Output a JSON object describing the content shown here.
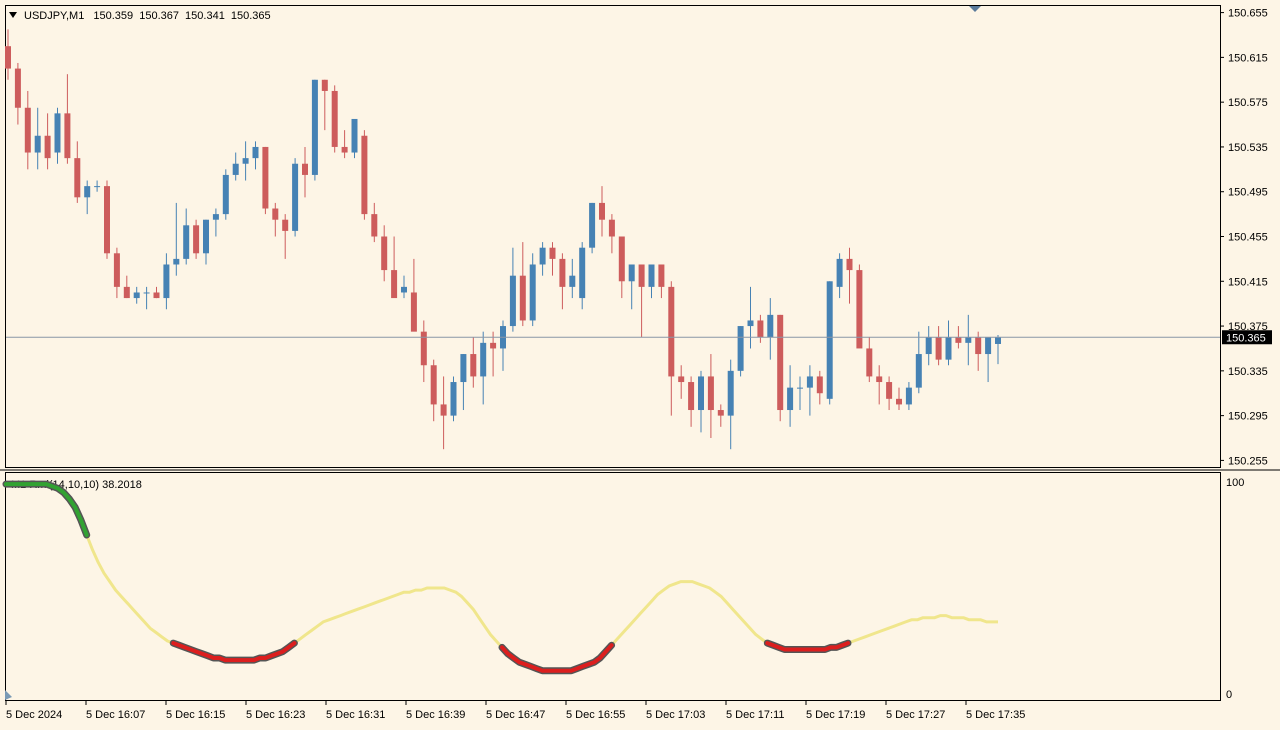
{
  "header": {
    "symbol": "USDJPY,M1",
    "open": "150.359",
    "high": "150.367",
    "low": "150.341",
    "close": "150.365"
  },
  "indicator": {
    "label": "M1 Rmi(14,10,10) 38.2018",
    "scale_max": "100",
    "scale_min": "0"
  },
  "current_price": "150.365",
  "colors": {
    "background": "#fdf5e6",
    "bull": "#4682b4",
    "bear": "#cd5c5c",
    "rmi_neutral": "#f0e68c",
    "rmi_up": "#32a232",
    "rmi_down": "#dc1e1e"
  },
  "chart_data": [
    {
      "type": "candlestick",
      "price_ticks": [
        "150.655",
        "150.615",
        "150.575",
        "150.535",
        "150.495",
        "150.455",
        "150.415",
        "150.375",
        "150.335",
        "150.295",
        "150.255"
      ],
      "ylim": [
        150.25,
        150.66
      ],
      "time_ticks": [
        "5 Dec 2024",
        "5 Dec 16:07",
        "5 Dec 16:15",
        "5 Dec 16:23",
        "5 Dec 16:31",
        "5 Dec 16:39",
        "5 Dec 16:47",
        "5 Dec 16:55",
        "5 Dec 17:03",
        "5 Dec 17:11",
        "5 Dec 17:19",
        "5 Dec 17:27",
        "5 Dec 17:35"
      ],
      "candles": [
        [
          150.625,
          150.64,
          150.595,
          150.605
        ],
        [
          150.605,
          150.61,
          150.555,
          150.57
        ],
        [
          150.57,
          150.585,
          150.515,
          150.53
        ],
        [
          150.53,
          150.57,
          150.515,
          150.545
        ],
        [
          150.545,
          150.565,
          150.515,
          150.525
        ],
        [
          150.53,
          150.57,
          150.52,
          150.565
        ],
        [
          150.565,
          150.6,
          150.52,
          150.525
        ],
        [
          150.525,
          150.54,
          150.485,
          150.49
        ],
        [
          150.49,
          150.505,
          150.475,
          150.5
        ],
        [
          150.5,
          150.505,
          150.495,
          150.5
        ],
        [
          150.5,
          150.505,
          150.435,
          150.44
        ],
        [
          150.44,
          150.445,
          150.4,
          150.41
        ],
        [
          150.41,
          150.42,
          150.4,
          150.4
        ],
        [
          150.4,
          150.41,
          150.395,
          150.405
        ],
        [
          150.405,
          150.41,
          150.39,
          150.405
        ],
        [
          150.405,
          150.41,
          150.4,
          150.4
        ],
        [
          150.4,
          150.44,
          150.39,
          150.43
        ],
        [
          150.43,
          150.485,
          150.42,
          150.435
        ],
        [
          150.435,
          150.48,
          150.43,
          150.465
        ],
        [
          150.465,
          150.47,
          150.435,
          150.44
        ],
        [
          150.44,
          150.47,
          150.43,
          150.47
        ],
        [
          150.47,
          150.48,
          150.455,
          150.475
        ],
        [
          150.475,
          150.515,
          150.47,
          150.51
        ],
        [
          150.51,
          150.53,
          150.505,
          150.52
        ],
        [
          150.52,
          150.54,
          150.505,
          150.525
        ],
        [
          150.525,
          150.54,
          150.515,
          150.535
        ],
        [
          150.535,
          150.535,
          150.475,
          150.48
        ],
        [
          150.48,
          150.485,
          150.455,
          150.47
        ],
        [
          150.47,
          150.475,
          150.435,
          150.46
        ],
        [
          150.46,
          150.525,
          150.455,
          150.52
        ],
        [
          150.52,
          150.535,
          150.49,
          150.51
        ],
        [
          150.51,
          150.595,
          150.505,
          150.595
        ],
        [
          150.595,
          150.595,
          150.55,
          150.585
        ],
        [
          150.585,
          150.59,
          150.53,
          150.535
        ],
        [
          150.535,
          150.55,
          150.525,
          150.53
        ],
        [
          150.53,
          150.56,
          150.525,
          150.56
        ],
        [
          150.545,
          150.55,
          150.47,
          150.475
        ],
        [
          150.475,
          150.485,
          150.45,
          150.455
        ],
        [
          150.455,
          150.465,
          150.415,
          150.425
        ],
        [
          150.425,
          150.455,
          150.405,
          150.4
        ],
        [
          150.405,
          150.42,
          150.4,
          150.41
        ],
        [
          150.405,
          150.435,
          150.375,
          150.37
        ],
        [
          150.37,
          150.38,
          150.325,
          150.34
        ],
        [
          150.34,
          150.345,
          150.29,
          150.305
        ],
        [
          150.305,
          150.33,
          150.265,
          150.295
        ],
        [
          150.295,
          150.33,
          150.29,
          150.325
        ],
        [
          150.325,
          150.35,
          150.3,
          150.35
        ],
        [
          150.35,
          150.365,
          150.32,
          150.33
        ],
        [
          150.33,
          150.37,
          150.305,
          150.36
        ],
        [
          150.36,
          150.37,
          150.33,
          150.355
        ],
        [
          150.355,
          150.38,
          150.335,
          150.375
        ],
        [
          150.375,
          150.445,
          150.37,
          150.42
        ],
        [
          150.42,
          150.45,
          150.375,
          150.38
        ],
        [
          150.38,
          150.44,
          150.375,
          150.43
        ],
        [
          150.43,
          150.45,
          150.42,
          150.445
        ],
        [
          150.445,
          150.45,
          150.42,
          150.435
        ],
        [
          150.435,
          150.44,
          150.39,
          150.41
        ],
        [
          150.41,
          150.435,
          150.4,
          150.42
        ],
        [
          150.4,
          150.45,
          150.39,
          150.445
        ],
        [
          150.445,
          150.485,
          150.44,
          150.485
        ],
        [
          150.485,
          150.5,
          150.455,
          150.47
        ],
        [
          150.47,
          150.475,
          150.44,
          150.455
        ],
        [
          150.455,
          150.455,
          150.4,
          150.415
        ],
        [
          150.415,
          150.43,
          150.39,
          150.43
        ],
        [
          150.43,
          150.43,
          150.365,
          150.41
        ],
        [
          150.41,
          150.43,
          150.4,
          150.43
        ],
        [
          150.43,
          150.43,
          150.4,
          150.41
        ],
        [
          150.41,
          150.415,
          150.295,
          150.33
        ],
        [
          150.33,
          150.34,
          150.31,
          150.325
        ],
        [
          150.325,
          150.33,
          150.285,
          150.3
        ],
        [
          150.3,
          150.335,
          150.28,
          150.33
        ],
        [
          150.33,
          150.35,
          150.275,
          150.3
        ],
        [
          150.3,
          150.305,
          150.285,
          150.295
        ],
        [
          150.295,
          150.345,
          150.265,
          150.335
        ],
        [
          150.335,
          150.375,
          150.33,
          150.375
        ],
        [
          150.375,
          150.41,
          150.355,
          150.38
        ],
        [
          150.38,
          150.385,
          150.36,
          150.365
        ],
        [
          150.365,
          150.4,
          150.345,
          150.385
        ],
        [
          150.385,
          150.385,
          150.29,
          150.3
        ],
        [
          150.3,
          150.34,
          150.285,
          150.32
        ],
        [
          150.32,
          150.33,
          150.3,
          150.32
        ],
        [
          150.32,
          150.34,
          150.295,
          150.33
        ],
        [
          150.33,
          150.335,
          150.305,
          150.315
        ],
        [
          150.31,
          150.415,
          150.305,
          150.415
        ],
        [
          150.41,
          150.44,
          150.4,
          150.435
        ],
        [
          150.435,
          150.445,
          150.395,
          150.425
        ],
        [
          150.425,
          150.43,
          150.37,
          150.355
        ],
        [
          150.355,
          150.365,
          150.325,
          150.33
        ],
        [
          150.33,
          150.34,
          150.305,
          150.325
        ],
        [
          150.325,
          150.33,
          150.3,
          150.31
        ],
        [
          150.31,
          150.32,
          150.3,
          150.305
        ],
        [
          150.305,
          150.325,
          150.3,
          150.32
        ],
        [
          150.32,
          150.37,
          150.315,
          150.35
        ],
        [
          150.35,
          150.375,
          150.34,
          150.365
        ],
        [
          150.365,
          150.375,
          150.34,
          150.345
        ],
        [
          150.345,
          150.38,
          150.34,
          150.365
        ],
        [
          150.365,
          150.375,
          150.355,
          150.36
        ],
        [
          150.36,
          150.385,
          150.34,
          150.365
        ],
        [
          150.365,
          150.37,
          150.335,
          150.35
        ],
        [
          150.35,
          150.365,
          150.325,
          150.365
        ],
        [
          150.359,
          150.367,
          150.341,
          150.365
        ]
      ]
    },
    {
      "type": "line",
      "name": "M1 Rmi(14,10,10)",
      "ylim": [
        0,
        100
      ],
      "values": [
        99,
        99,
        99,
        99,
        99,
        99,
        99,
        99,
        98,
        97,
        95,
        92,
        88,
        82,
        75,
        68,
        62,
        57,
        53,
        49,
        46,
        43,
        40,
        37,
        34,
        31,
        29,
        27,
        25,
        24,
        23,
        22,
        21,
        20,
        19,
        18,
        17,
        17,
        16,
        16,
        16,
        16,
        16,
        16,
        17,
        17,
        18,
        19,
        20,
        22,
        24,
        26,
        28,
        30,
        32,
        34,
        35,
        36,
        37,
        38,
        39,
        40,
        41,
        42,
        43,
        44,
        45,
        46,
        47,
        48,
        48,
        49,
        49,
        50,
        50,
        50,
        50,
        49,
        48,
        46,
        43,
        40,
        36,
        32,
        28,
        25,
        22,
        19,
        17,
        15,
        14,
        13,
        12,
        11,
        11,
        11,
        11,
        11,
        11,
        12,
        13,
        14,
        15,
        17,
        20,
        23,
        26,
        29,
        32,
        35,
        38,
        41,
        44,
        47,
        49,
        51,
        52,
        53,
        53,
        53,
        52,
        51,
        50,
        48,
        46,
        43,
        40,
        37,
        34,
        31,
        28,
        26,
        24,
        23,
        22,
        21,
        21,
        21,
        21,
        21,
        21,
        21,
        21,
        22,
        22,
        23,
        24,
        25,
        26,
        27,
        28,
        29,
        30,
        31,
        32,
        33,
        34,
        35,
        35,
        36,
        36,
        36,
        37,
        37,
        36,
        36,
        36,
        35,
        35,
        35,
        34,
        34,
        34
      ]
    }
  ]
}
